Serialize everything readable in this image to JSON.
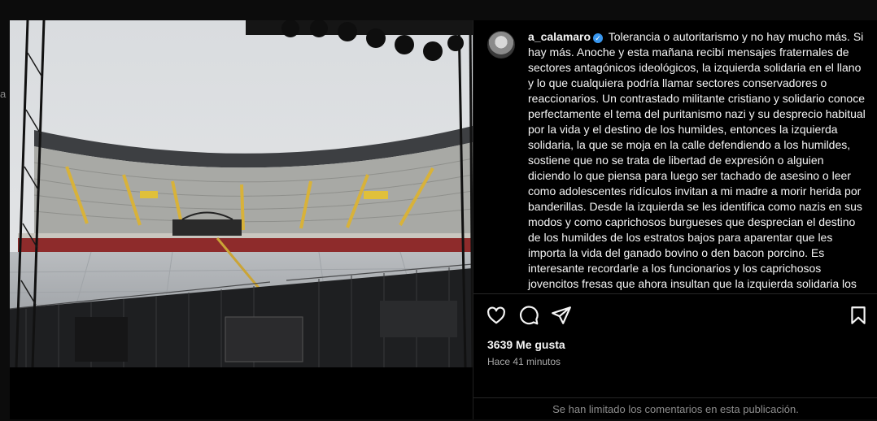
{
  "edge_text": "a",
  "post": {
    "username": "a_calamaro",
    "caption": "Tolerancia o autoritarismo y no hay mucho más. Si hay más. Anoche y esta mañana recibí mensajes fraternales de sectores antagónicos ideológicos, la izquierda solidaria en el llano y lo que cualquiera podría llamar sectores conservadores o reaccionarios. Un contrastado militante cristiano y solidario conoce perfectamente el tema del puritanismo nazi y su desprecio habitual por la vida y el destino de los humildes, entonces la izquierda solidaria, la que se moja en la calle defendiendo a los humildes, sostiene que no se trata de libertad de expresión o alguien diciendo lo que piensa para luego ser tachado de asesino o leer como adolescentes ridículos invitan a mi madre a morir herida por banderillas. Desde la izquierda se les identifica como nazis en sus modos y como caprichosos burgueses que desprecian el destino de los humildes de los estratos bajos para aparentar que les importa la vida del ganado bovino o den bacon porcino. Es interesante recordarle a los funcionarios y los caprichosos jovencitos fresas que ahora insultan que la izquierda solidaria los desprecia por egoístas desprendidos, egoístas y e imperdonables. Es verdad que son",
    "likes": "3639 Me gusta",
    "time": "Hace 41 minutos",
    "comments_notice": "Se han limitado los comentarios en esta publicación.",
    "verified_badge": "✓"
  },
  "icons": {
    "like": "heart-icon",
    "comment": "comment-bubble-icon",
    "share": "paper-plane-icon",
    "save": "bookmark-icon"
  },
  "colors": {
    "background": "#000000",
    "verified": "#3897f0",
    "secondary_text": "#a8a8a8"
  }
}
